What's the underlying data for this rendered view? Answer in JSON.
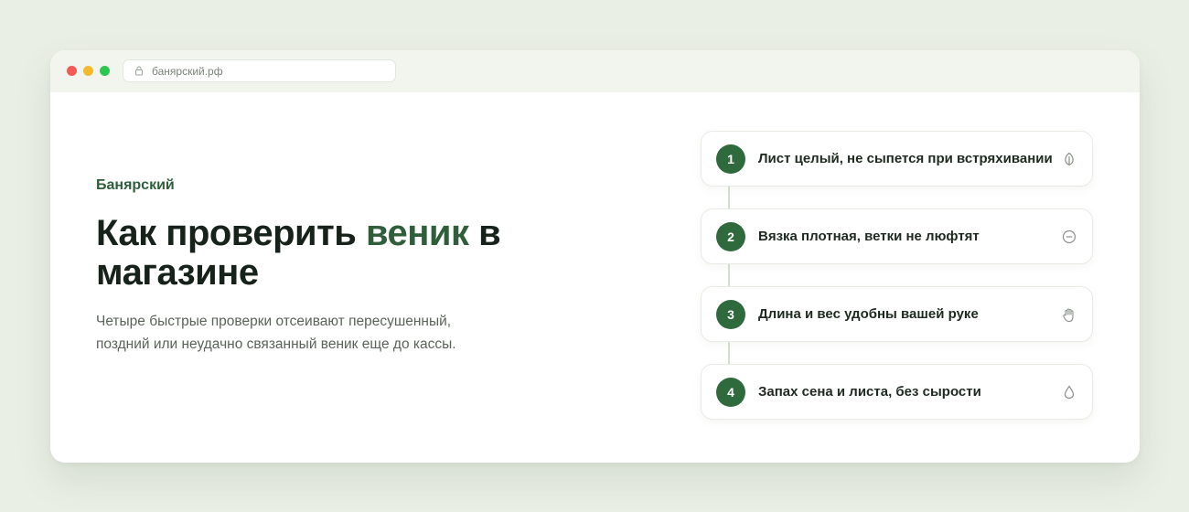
{
  "browser": {
    "url": "банярский.рф"
  },
  "hero": {
    "eyebrow": "Банярский",
    "title_before": "Как проверить ",
    "title_accent": "веник",
    "title_after": " в магазине",
    "description": "Четыре быстрые проверки отсеивают пересушенный, поздний или неудачно связанный веник еще до кассы."
  },
  "steps": [
    {
      "number": "1",
      "label": "Лист целый, не сыпется при встряхивании",
      "icon": "leaf-icon"
    },
    {
      "number": "2",
      "label": "Вязка плотная, ветки не люфтят",
      "icon": "minus-circle-icon"
    },
    {
      "number": "3",
      "label": "Длина и вес удобны вашей руке",
      "icon": "hand-icon"
    },
    {
      "number": "4",
      "label": "Запах сена и листа, без сырости",
      "icon": "drop-icon"
    }
  ],
  "colors": {
    "accent": "#2f5e3a",
    "step_circle": "#2f6a3d",
    "page_background": "#eaefe6"
  }
}
